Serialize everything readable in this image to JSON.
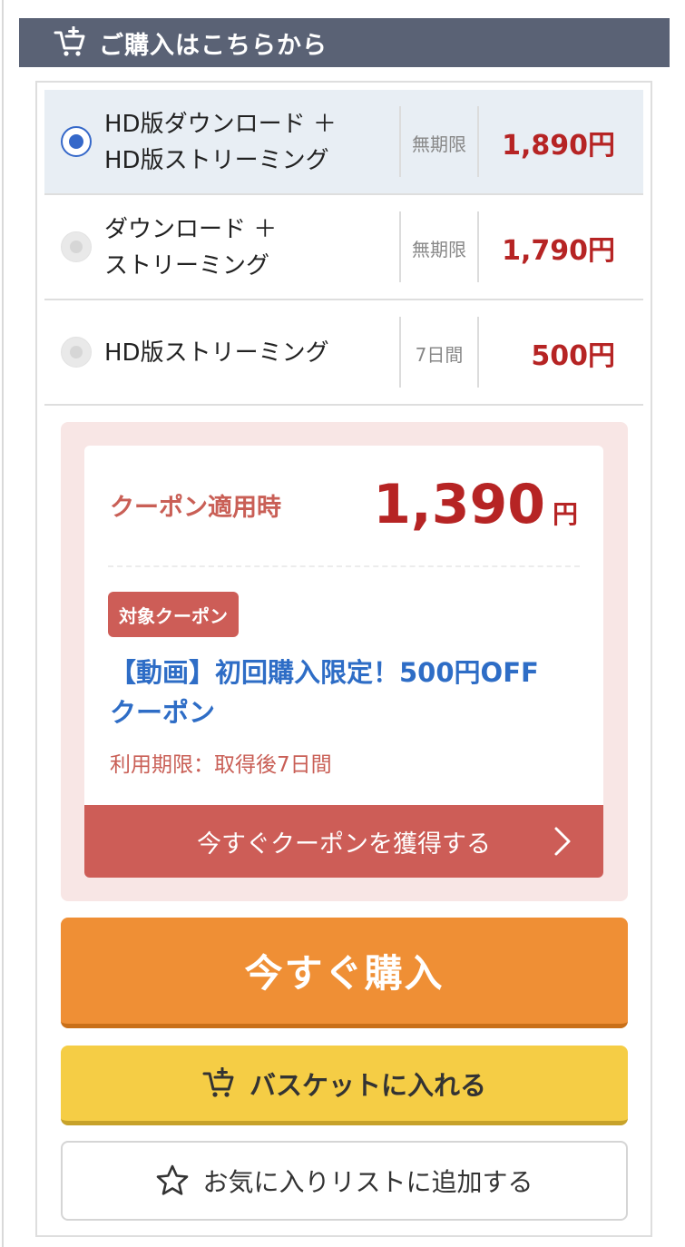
{
  "header": {
    "title": "ご購入はこちらから",
    "icon": "cart-plus-icon"
  },
  "options": [
    {
      "name_line1": "HD版ダウンロード ＋",
      "name_line2": "HD版ストリーミング",
      "period": "無期限",
      "price": "1,890円",
      "selected": true
    },
    {
      "name_line1": "ダウンロード ＋",
      "name_line2": "ストリーミング",
      "period": "無期限",
      "price": "1,790円",
      "selected": false
    },
    {
      "name_line1": "HD版ストリーミング",
      "name_line2": "",
      "period": "7日間",
      "price": "500円",
      "selected": false
    }
  ],
  "coupon": {
    "label": "クーポン適用時",
    "price": "1,390",
    "currency": "円",
    "tag": "対象クーポン",
    "name_line1": "【動画】初回購入限定！500円OFF",
    "name_line2": "クーポン",
    "expiry": "利用期限：取得後7日間",
    "button_label": "今すぐクーポンを獲得する"
  },
  "actions": {
    "buy_label": "今すぐ購入",
    "basket_label": "バスケットに入れる",
    "favorite_label": "お気に入りリストに追加する"
  },
  "colors": {
    "header_bg": "#5a6275",
    "price_red": "#b62424",
    "coupon_red": "#cd5d57",
    "coupon_blue": "#2e6dc6",
    "buy_orange": "#ef8f35",
    "basket_yellow": "#f5cd45",
    "selected_bg": "#e8eef4",
    "radio_blue": "#3568c9"
  }
}
